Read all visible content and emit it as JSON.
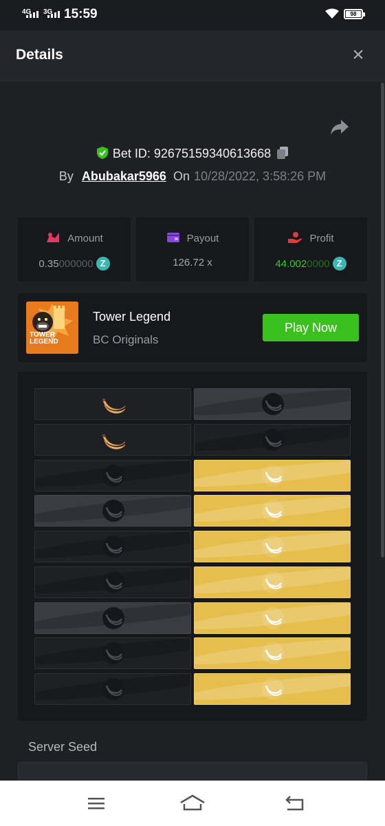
{
  "status_bar": {
    "network1": "4G",
    "network2": "3G",
    "time": "15:59",
    "battery": "98"
  },
  "header": {
    "title": "Details",
    "close_symbol": "×"
  },
  "bet": {
    "id_text": "Bet ID: 92675159340613668",
    "by_label": "By",
    "username": "Abubakar5966",
    "on_label": "On",
    "date": "10/28/2022, 3:58:26 PM"
  },
  "stats": {
    "amount": {
      "label": "Amount",
      "value_main": "0.35",
      "value_dim": "000000",
      "icon": "amount-icon",
      "icon_color": "#e3385f"
    },
    "payout": {
      "label": "Payout",
      "value": "126.72 x",
      "icon": "wallet-icon",
      "icon_color": "#8a45e6"
    },
    "profit": {
      "label": "Profit",
      "value_main": "44.002",
      "value_dim": "0000",
      "icon": "profit-hand-icon",
      "icon_color": "#e23b3b"
    }
  },
  "game": {
    "thumb_text": "TOWER LEGEND",
    "name": "Tower Legend",
    "provider": "BC Originals",
    "play_label": "Play Now"
  },
  "board": {
    "rows": [
      [
        "banana",
        "light"
      ],
      [
        "banana",
        "dark"
      ],
      [
        "dark",
        "gold"
      ],
      [
        "light",
        "gold"
      ],
      [
        "dark",
        "gold"
      ],
      [
        "dark",
        "gold"
      ],
      [
        "light",
        "gold"
      ],
      [
        "dark",
        "gold"
      ],
      [
        "dark",
        "gold"
      ]
    ],
    "colors": {
      "gold": "#e5be4c",
      "dark": "#1f2024",
      "light": "#3a3c43"
    }
  },
  "server_seed": {
    "label": "Server Seed"
  },
  "colors": {
    "background": "#1e2024",
    "accent_green": "#3bc11e",
    "coin": "#3bb6b0"
  }
}
